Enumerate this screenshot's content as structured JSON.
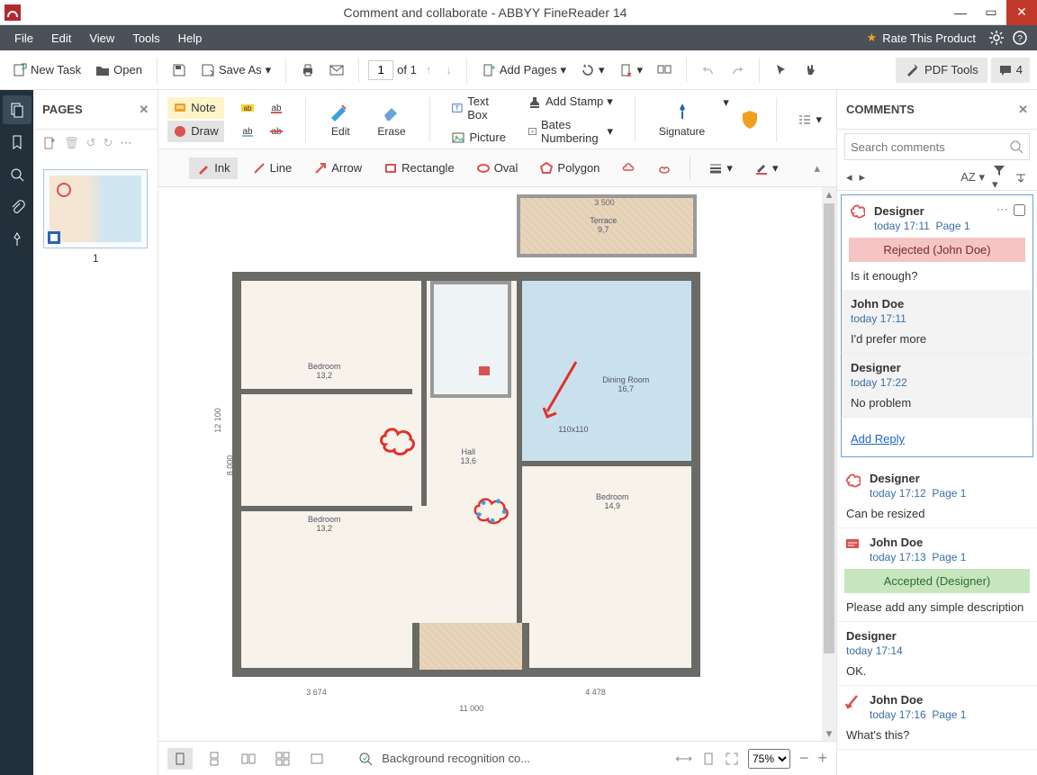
{
  "titlebar": {
    "title": "Comment and collaborate - ABBYY FineReader 14"
  },
  "menu": {
    "file": "File",
    "edit": "Edit",
    "view": "View",
    "tools": "Tools",
    "help": "Help",
    "rate": "Rate This Product"
  },
  "toolbar": {
    "new_task": "New Task",
    "open": "Open",
    "save_as": "Save As",
    "page_current": "1",
    "page_total": "of 1",
    "add_pages": "Add Pages",
    "pdf_tools": "PDF Tools",
    "comment_count": "4"
  },
  "panels": {
    "pages_title": "PAGES",
    "comments_title": "COMMENTS",
    "thumb_label": "1"
  },
  "edit_tools": {
    "note": "Note",
    "draw": "Draw",
    "edit": "Edit",
    "erase": "Erase",
    "textbox": "Text Box",
    "picture": "Picture",
    "add_stamp": "Add Stamp",
    "bates": "Bates Numbering",
    "signature": "Signature"
  },
  "shapes": {
    "ink": "Ink",
    "line": "Line",
    "arrow": "Arrow",
    "rectangle": "Rectangle",
    "oval": "Oval",
    "polygon": "Polygon"
  },
  "canvas": {
    "terrace": "Terrace",
    "terrace_sub": "9,7",
    "dining": "Dining Room",
    "dining_sub": "16,7",
    "bedroom1": "Bedroom",
    "bedroom1_sub": "13,2",
    "bedroom2": "Bedroom",
    "bedroom2_sub": "13,2",
    "bedroom3": "Bedroom",
    "bedroom3_sub": "14,9",
    "hall": "Hall",
    "hall_sub": "13,6",
    "dims": {
      "top1": "3 500",
      "bottom": "11 000",
      "b1": "3 674",
      "b2": "4 478",
      "side1": "12 100",
      "side2": "8 000"
    },
    "room_dim1": "110x110"
  },
  "statusbar": {
    "bg_recog": "Background recognition co...",
    "zoom": "75%"
  },
  "comments": {
    "search_placeholder": "Search comments",
    "sort_label": "AZ",
    "items": [
      {
        "icon": "cloud",
        "author": "Designer",
        "time": "today 17:11",
        "page": "Page 1",
        "status": "Rejected (John Doe)",
        "status_kind": "rejected",
        "body": "Is it enough?",
        "thread_head": true,
        "controls": true
      },
      {
        "reply": true,
        "author": "John Doe",
        "time": "today 17:11",
        "body": "I'd prefer more"
      },
      {
        "reply": true,
        "author": "Designer",
        "time": "today 17:22",
        "body": "No problem"
      },
      {
        "add_reply": "Add Reply",
        "thread_end": true
      },
      {
        "icon": "cloud",
        "author": "Designer",
        "time": "today 17:12",
        "page": "Page 1",
        "body": "Can be resized"
      },
      {
        "icon": "textbox",
        "author": "John Doe",
        "time": "today 17:13",
        "page": "Page 1",
        "status": "Accepted (Designer)",
        "status_kind": "accepted",
        "body": "Please add any simple description"
      },
      {
        "reply": true,
        "author": "Designer",
        "time": "today 17:14",
        "body": "OK."
      },
      {
        "icon": "arrow",
        "author": "John Doe",
        "time": "today 17:16",
        "page": "Page 1",
        "body": "What's this?"
      }
    ]
  }
}
